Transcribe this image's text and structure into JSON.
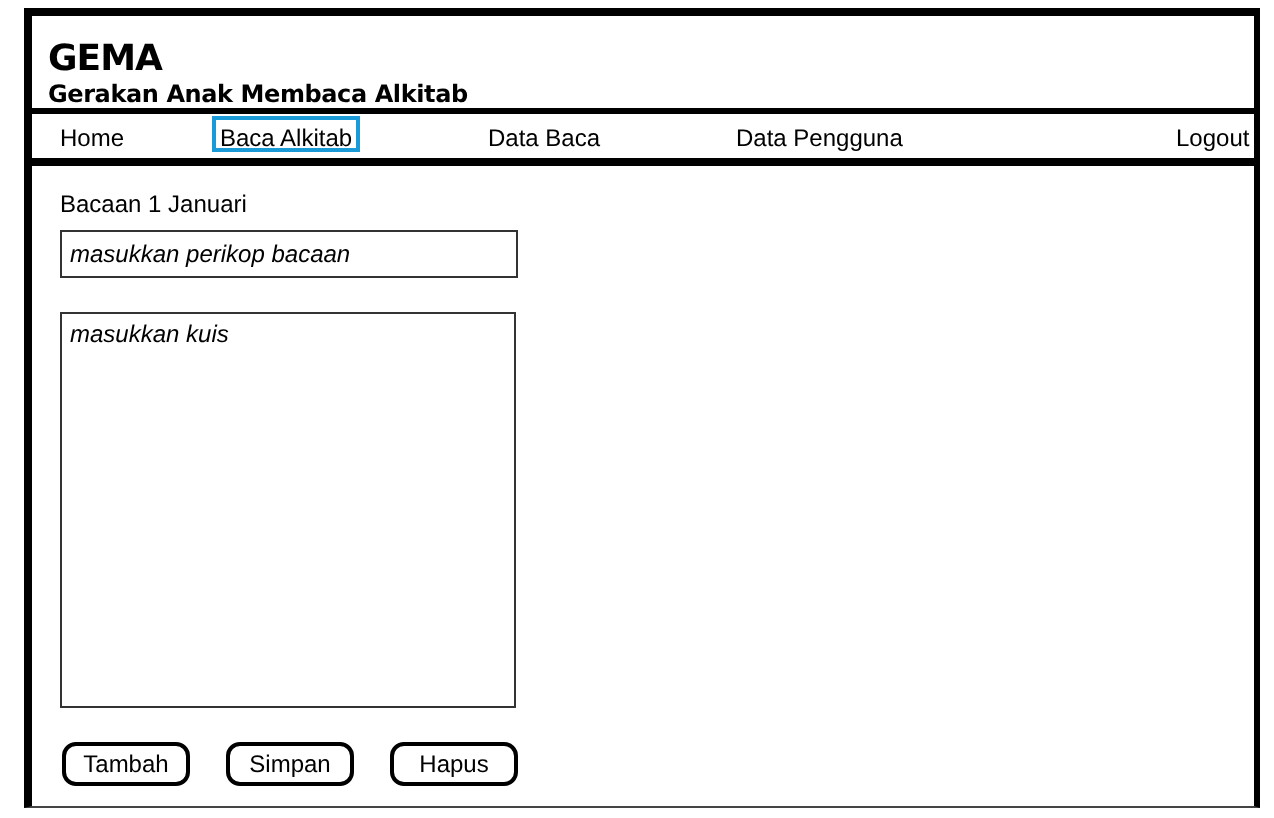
{
  "app": {
    "title": "GEMA",
    "subtitle": "Gerakan Anak Membaca Alkitab"
  },
  "nav": [
    {
      "label": "Home",
      "selected": false
    },
    {
      "label": "Baca Alkitab",
      "selected": true
    },
    {
      "label": "Data Baca",
      "selected": false
    },
    {
      "label": "Data Pengguna",
      "selected": false
    },
    {
      "label": "Logout",
      "selected": false
    }
  ],
  "form": {
    "heading": "Bacaan 1 Januari",
    "passage_field": {
      "placeholder": "masukkan perikop bacaan"
    },
    "quiz_field": {
      "placeholder": "masukkan kuis"
    }
  },
  "buttons": [
    "Tambah",
    "Simpan",
    "Hapus"
  ]
}
